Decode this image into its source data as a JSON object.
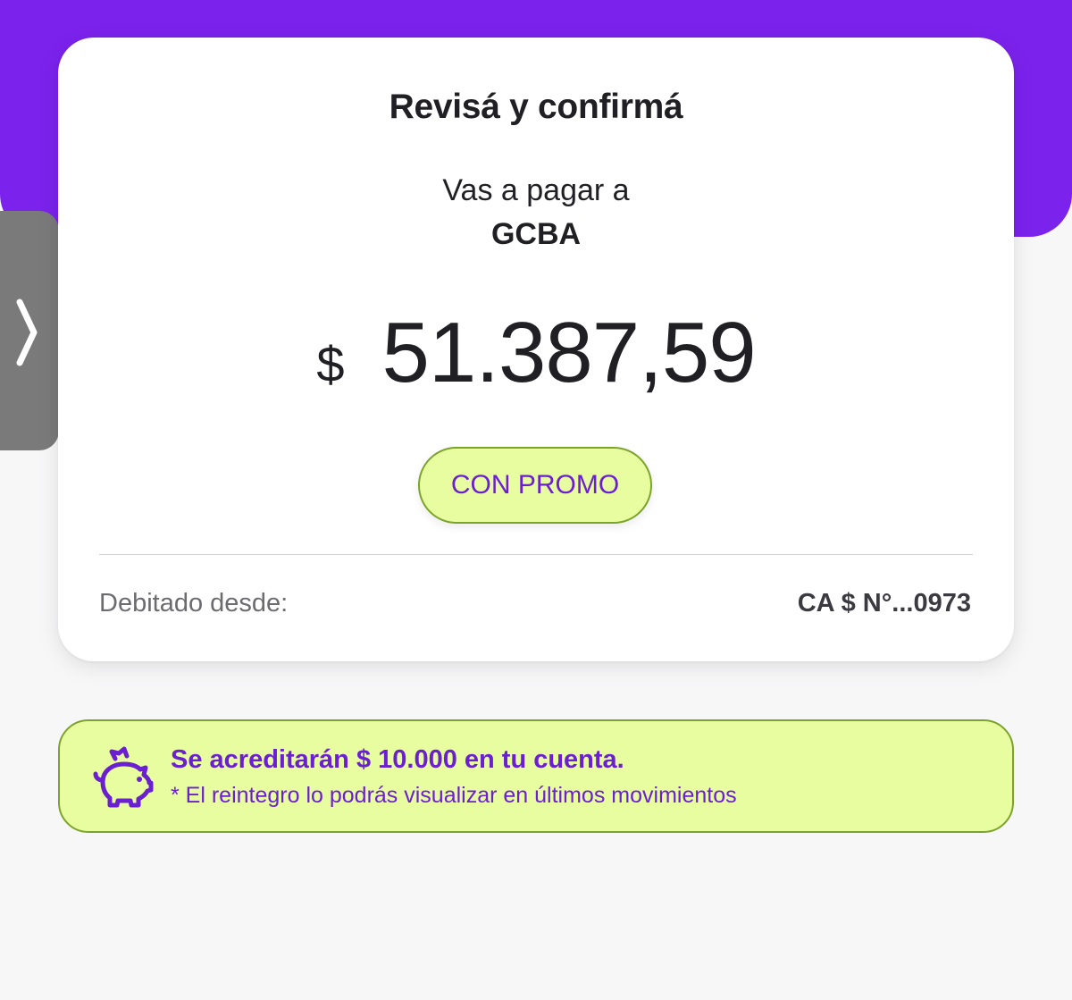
{
  "header": {
    "title": "Revisá y confirmá"
  },
  "payment": {
    "pay_to_label": "Vas a pagar a",
    "payee": "GCBA",
    "currency": "$",
    "amount": "51.387,59",
    "promo_label": "CON PROMO"
  },
  "debit": {
    "label": "Debitado desde:",
    "account": "CA $ N°...0973"
  },
  "promo_banner": {
    "title": "Se acreditarán $ 10.000 en tu cuenta.",
    "subtitle": "* El reintegro lo podrás visualizar en últimos movimientos"
  },
  "icons": {
    "side_tab": "chevron-right-icon",
    "banner": "piggy-bank-icon"
  },
  "colors": {
    "brand_purple": "#7b22ec",
    "promo_green": "#e8fda0",
    "promo_border": "#7ca32b",
    "promo_text": "#6a1fd0"
  }
}
